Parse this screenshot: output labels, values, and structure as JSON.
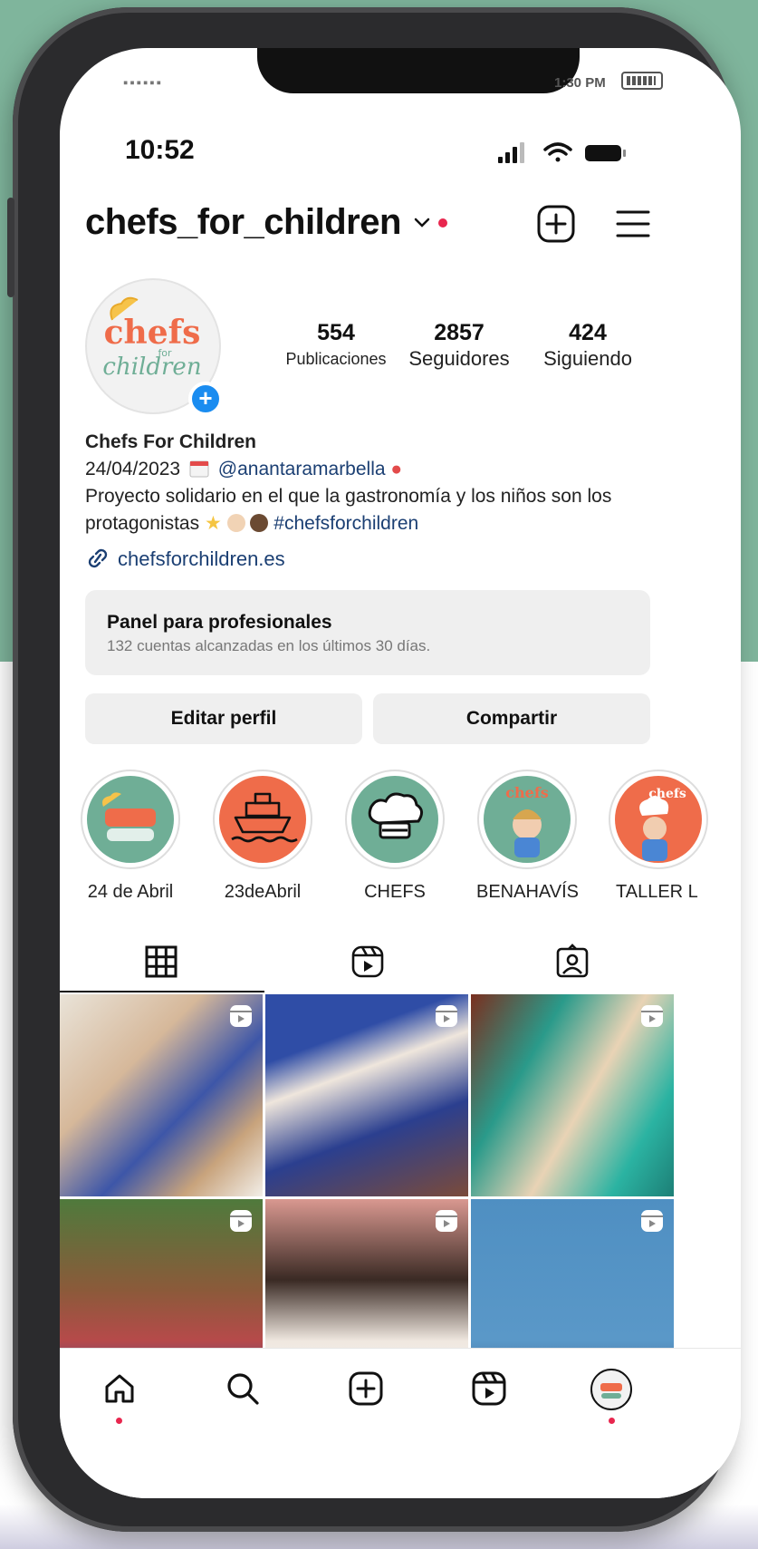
{
  "legacy_status": {
    "dots": "▪▪▪▪▪▪",
    "time": "1:30 PM"
  },
  "status_bar": {
    "time": "10:52"
  },
  "profile": {
    "username": "chefs_for_children",
    "avatar_text_top": "chefs",
    "avatar_text_mid": "for",
    "avatar_text_bottom": "children",
    "stats": [
      {
        "value": "554",
        "label": "Publicaciones"
      },
      {
        "value": "2857",
        "label": "Seguidores"
      },
      {
        "value": "424",
        "label": "Siguiendo"
      }
    ],
    "display_name": "Chefs For Children",
    "bio_date": "24/04/2023",
    "bio_mention": "@anantaramarbella",
    "bio_text": "Proyecto solidario en el que la gastronomía y los niños son los protagonistas",
    "bio_hashtag": "#chefsforchildren",
    "website": "chefsforchildren.es"
  },
  "panel": {
    "title": "Panel para profesionales",
    "subtitle": "132 cuentas alcanzadas en los últimos 30 días."
  },
  "actions": {
    "edit": "Editar perfil",
    "share": "Compartir"
  },
  "highlights": [
    {
      "label": "24 de Abril"
    },
    {
      "label": "23deAbril"
    },
    {
      "label": "CHEFS"
    },
    {
      "label": "BENAHAVÍS"
    },
    {
      "label": "TALLER L"
    }
  ],
  "colors": {
    "accent_green": "#6fae96",
    "accent_orange": "#ef6c4a",
    "notification": "#e8264e",
    "link": "#1b3f73"
  },
  "icons": [
    "chevron-down-icon",
    "plus-square-icon",
    "menu-icon",
    "grid-icon",
    "reels-icon",
    "tagged-icon",
    "home-icon",
    "search-icon",
    "reel-icon",
    "link-icon"
  ]
}
